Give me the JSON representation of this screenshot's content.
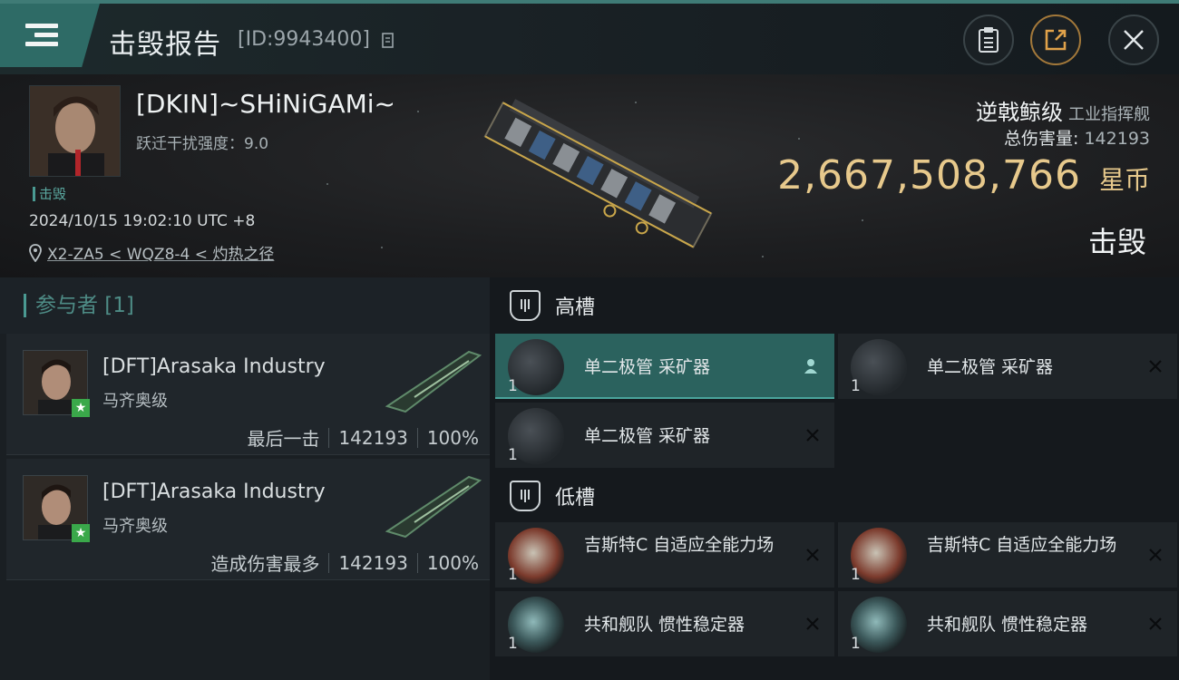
{
  "header": {
    "title": "击毁报告",
    "id_text": "[ID:9943400]"
  },
  "victim": {
    "status_tag": "击毁",
    "name": "[DKIN]~SHiNiGAMi~",
    "warp_scramble": "跃迁干扰强度：9.0",
    "time": "2024/10/15 19:02:10 UTC +8",
    "location": "X2-ZA5 < WQZ8-4 < 灼热之径"
  },
  "ship": {
    "name": "逆戟鲸级",
    "class": "工业指挥舰",
    "damage_label": "总伤害量:",
    "damage_value": "142193",
    "isk_value": "2,667,508,766",
    "isk_unit": "星币",
    "result": "击毁"
  },
  "participants": {
    "title": "参与者 [1]",
    "items": [
      {
        "name": "[DFT]Arasaka Industry",
        "ship": "马齐奥级",
        "role": "最后一击",
        "damage": "142193",
        "percent": "100%"
      },
      {
        "name": "[DFT]Arasaka Industry",
        "ship": "马齐奥级",
        "role": "造成伤害最多",
        "damage": "142193",
        "percent": "100%"
      }
    ]
  },
  "fitting": {
    "high_label": "高槽",
    "low_label": "低槽",
    "high": [
      {
        "qty": "1",
        "name": "单二极管 采矿器"
      },
      {
        "qty": "1",
        "name": "单二极管 采矿器"
      },
      {
        "qty": "1",
        "name": "单二极管 采矿器"
      }
    ],
    "low": [
      {
        "qty": "1",
        "name": "吉斯特C 自适应全能力场"
      },
      {
        "qty": "1",
        "name": "吉斯特C 自适应全能力场"
      },
      {
        "qty": "1",
        "name": "共和舰队 惯性稳定器"
      },
      {
        "qty": "1",
        "name": "共和舰队 惯性稳定器"
      }
    ]
  },
  "colors": {
    "accent": "#2e6b66",
    "isk": "#e7c98c",
    "corp_star": "#3aa84a"
  }
}
